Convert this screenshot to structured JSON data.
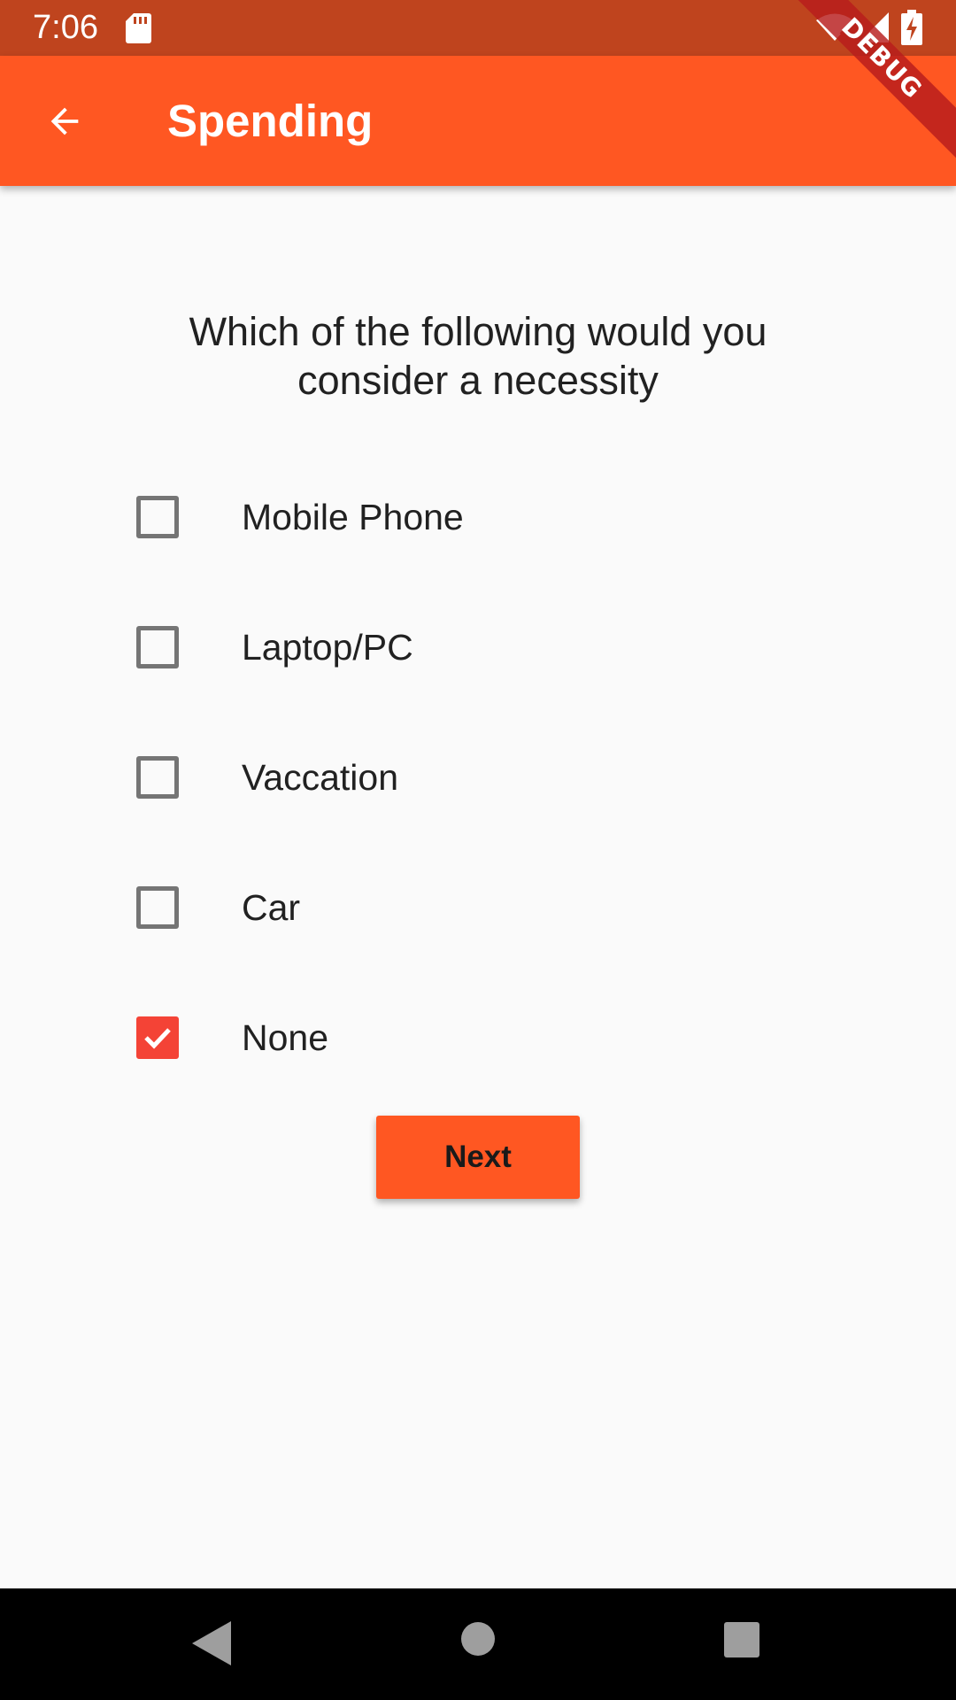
{
  "status_bar": {
    "time": "7:06",
    "icons": [
      "sd-card-icon",
      "wifi-icon",
      "signal-icon",
      "battery-icon"
    ]
  },
  "app_bar": {
    "title": "Spending",
    "back_icon": "arrow-back-icon",
    "color": "#ff5722"
  },
  "debug_banner": "DEBUG",
  "question": "Which of the following would you consider a necessity",
  "options": [
    {
      "label": "Mobile Phone",
      "checked": false
    },
    {
      "label": "Laptop/PC",
      "checked": false
    },
    {
      "label": "Vaccation",
      "checked": false
    },
    {
      "label": "Car",
      "checked": false
    },
    {
      "label": "None",
      "checked": true
    }
  ],
  "next_button": {
    "label": "Next"
  },
  "nav_bar": {
    "icons": [
      "nav-back-icon",
      "nav-home-icon",
      "nav-recents-icon"
    ]
  },
  "colors": {
    "accent": "#ff5722",
    "status_bar": "#bf441e",
    "checkbox_checked": "#f44336",
    "background": "#fafafa"
  }
}
